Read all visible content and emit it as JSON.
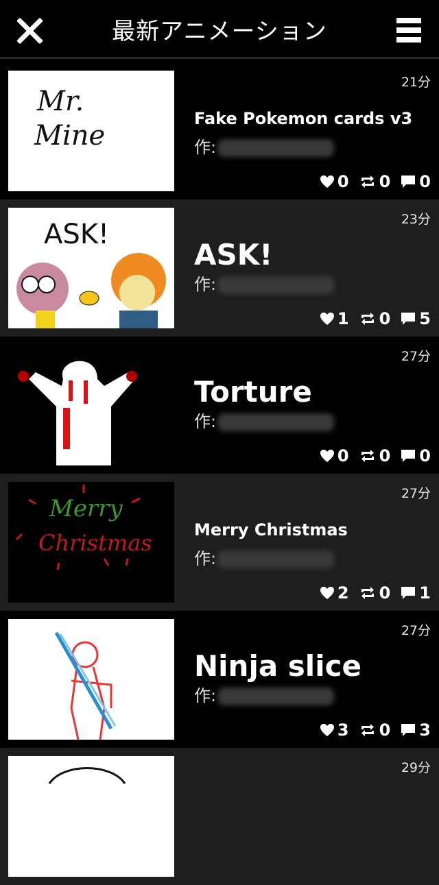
{
  "header": {
    "title": "最新アニメーション",
    "close_icon": "close-icon",
    "menu_icon": "hamburger-menu-icon"
  },
  "author_prefix": "作:",
  "items": [
    {
      "time": "21分",
      "title": "Fake Pokemon cards v3",
      "likes": "0",
      "reposts": "0",
      "comments": "0",
      "thumb_text": "Mr. Mine"
    },
    {
      "time": "23分",
      "title": "ASK!",
      "likes": "1",
      "reposts": "0",
      "comments": "5",
      "thumb_text": "ASK!"
    },
    {
      "time": "27分",
      "title": "Torture",
      "likes": "0",
      "reposts": "0",
      "comments": "0"
    },
    {
      "time": "27分",
      "title": "Merry Christmas",
      "likes": "2",
      "reposts": "0",
      "comments": "1",
      "thumb_text": "Merry Christmas"
    },
    {
      "time": "27分",
      "title": "Ninja slice",
      "likes": "3",
      "reposts": "0",
      "comments": "3"
    },
    {
      "time": "29分"
    }
  ]
}
